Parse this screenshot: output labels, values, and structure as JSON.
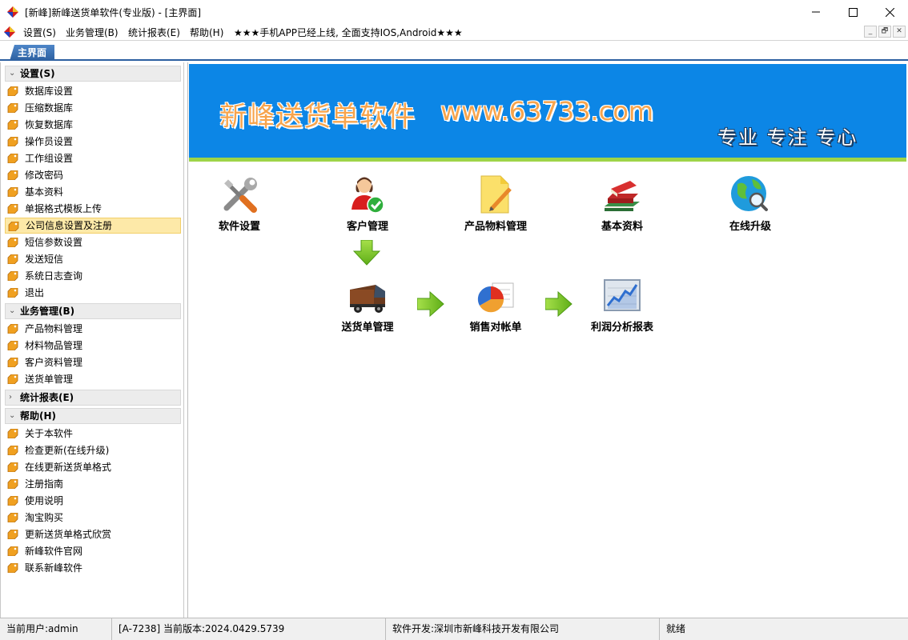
{
  "window": {
    "title": "[新峰]新峰送货单软件(专业版) - [主界面]",
    "minimize": "—",
    "maximize": "☐",
    "close": "✕"
  },
  "menu": {
    "items": [
      "设置(S)",
      "业务管理(B)",
      "统计报表(E)",
      "帮助(H)",
      "★★★手机APP已经上线, 全面支持IOS,Android★★★"
    ],
    "mdi_minimize": "_",
    "mdi_restore": "🗗",
    "mdi_close": "✕"
  },
  "tabs": {
    "main": "主界面"
  },
  "sidebar": {
    "groups": [
      {
        "title": "设置(S)",
        "expanded": true,
        "items": [
          "数据库设置",
          "压缩数据库",
          "恢复数据库",
          "操作员设置",
          "工作组设置",
          "修改密码",
          "基本资料",
          "单据格式模板上传",
          "公司信息设置及注册",
          "短信参数设置",
          "发送短信",
          "系统日志查询",
          "退出"
        ]
      },
      {
        "title": "业务管理(B)",
        "expanded": true,
        "items": [
          "产品物料管理",
          "材料物品管理",
          "客户资料管理",
          "送货单管理"
        ]
      },
      {
        "title": "统计报表(E)",
        "expanded": false,
        "items": []
      },
      {
        "title": "帮助(H)",
        "expanded": true,
        "items": [
          "关于本软件",
          "检查更新(在线升级)",
          "在线更新送货单格式",
          "注册指南",
          "使用说明",
          "淘宝购买",
          "更新送货单格式欣赏",
          "新峰软件官网",
          "联系新峰软件"
        ]
      }
    ],
    "selected": "公司信息设置及注册"
  },
  "banner": {
    "title": "新峰送货单软件",
    "url": "www.63733.com",
    "slogan": "专业 专注 专心"
  },
  "tiles": {
    "software_settings": "软件设置",
    "customer_mgmt": "客户管理",
    "product_mgmt": "产品物料管理",
    "basic_info": "基本资料",
    "online_upgrade": "在线升级",
    "delivery_mgmt": "送货单管理",
    "sales_statement": "销售对帐单",
    "profit_report": "利润分析报表"
  },
  "status": {
    "user": "当前用户:admin",
    "version": "[A-7238] 当前版本:2024.0429.5739",
    "developer": "软件开发:深圳市新峰科技开发有限公司",
    "state": "就绪"
  },
  "colors": {
    "banner_blue": "#0c86e6",
    "banner_green_line": "#9ed448",
    "tab_blue": "#2c5fa0",
    "selection_yellow": "#fde9a8",
    "arrow_green": "#7cc520"
  }
}
